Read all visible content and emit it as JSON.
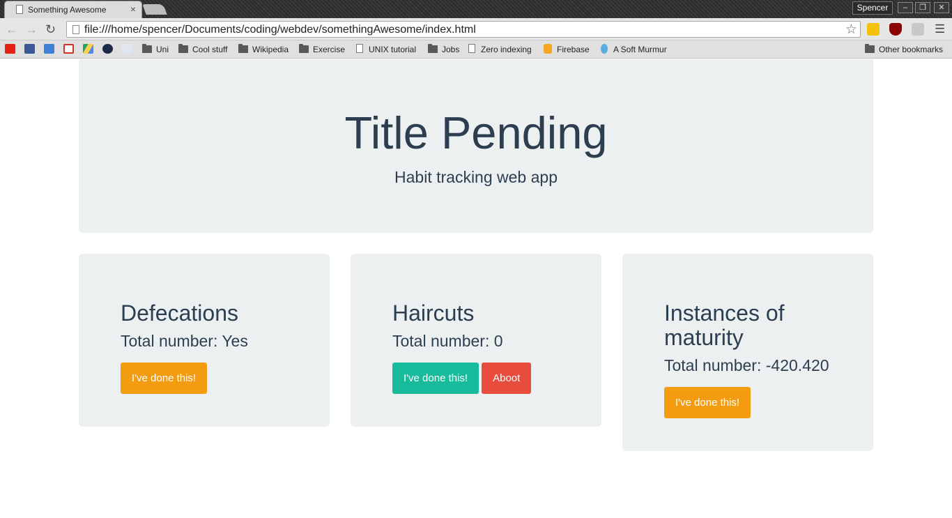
{
  "browser": {
    "tab_title": "Something Awesome",
    "tab_close": "×",
    "profile_name": "Spencer",
    "url": "file:///home/spencer/Documents/coding/webdev/somethingAwesome/index.html",
    "bookmarks": [
      {
        "label": "Uni"
      },
      {
        "label": "Cool stuff"
      },
      {
        "label": "Wikipedia"
      },
      {
        "label": "Exercise"
      },
      {
        "label": "UNIX tutorial"
      },
      {
        "label": "Jobs"
      },
      {
        "label": "Zero indexing"
      },
      {
        "label": "Firebase"
      },
      {
        "label": "A Soft Murmur"
      }
    ],
    "other_bookmarks": "Other bookmarks"
  },
  "jumbotron": {
    "title": "Title Pending",
    "subtitle": "Habit tracking web app"
  },
  "cards": [
    {
      "title": "Defecations",
      "total": "Total number: Yes",
      "done_label": "I've done this!"
    },
    {
      "title": "Haircuts",
      "total": "Total number: 0",
      "done_label": "I've done this!",
      "extra_label": "Aboot"
    },
    {
      "title": "Instances of maturity",
      "total": "Total number: -420.420",
      "done_label": "I've done this!"
    }
  ],
  "colors": {
    "warning": "#f39c12",
    "success": "#18bc9c",
    "danger": "#e74c3c",
    "panel": "#ecf0f1",
    "text": "#2c3e50"
  }
}
